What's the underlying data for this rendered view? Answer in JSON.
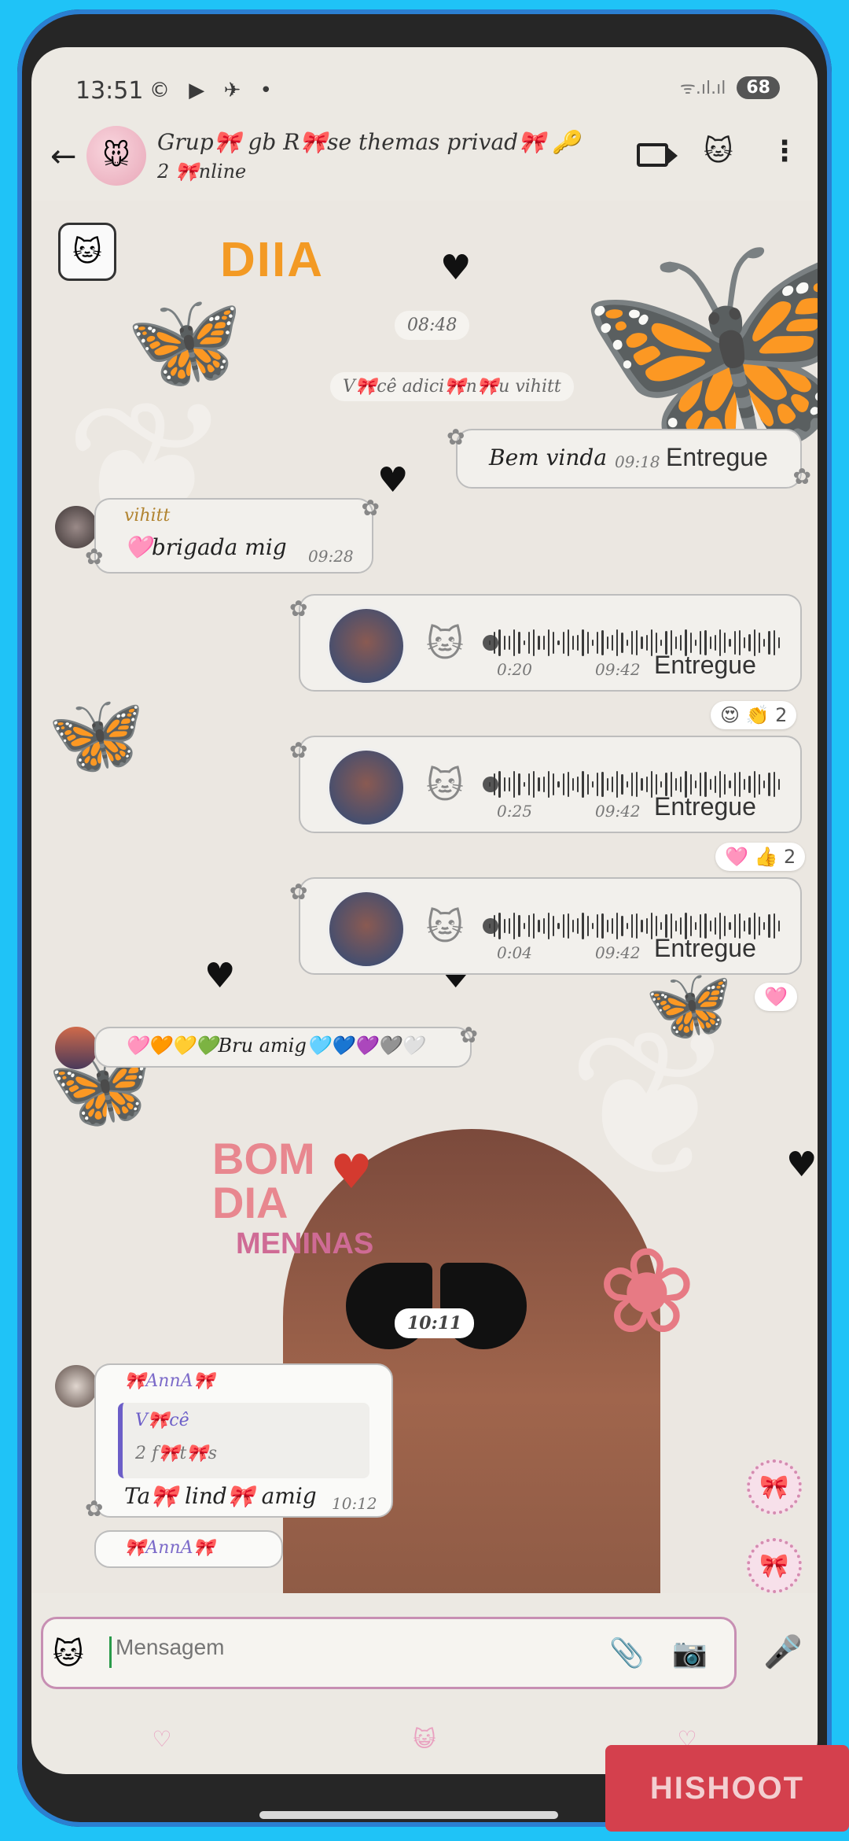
{
  "status_bar": {
    "time": "13:51",
    "app_icons": "© ▶ ✈ •",
    "signal": "ᯤ.ıl.ıl",
    "battery": "68"
  },
  "header": {
    "back_icon": "←",
    "group_name": "Grup🎀 gb R🎀se themas privad🎀 🔑",
    "group_status": "2 🎀nline",
    "avatar_icon": "🐭",
    "video_icon": "video-camera-icon",
    "cat_icon": "🐱",
    "more_icon": "⋮"
  },
  "chat": {
    "sticker_text": "DIIA",
    "time_pill_1": "08:48",
    "system_msg": "V🎀cê adici🎀n🎀u vihitt",
    "messages": [
      {
        "text": "Bem vinda",
        "time": "09:18",
        "status": "Entregue"
      },
      {
        "sender": "vihitt",
        "text": "🩷brigada mig",
        "time": "09:28"
      }
    ],
    "voice_messages": [
      {
        "duration": "0:20",
        "time": "09:42",
        "status": "Entregue",
        "reaction": "😍 👏 2"
      },
      {
        "duration": "0:25",
        "time": "09:42",
        "status": "Entregue",
        "reaction": "🩷 👍 2"
      },
      {
        "duration": "0:04",
        "time": "09:42",
        "status": "Entregue",
        "reaction": "🩷"
      }
    ],
    "emoji_msg": "🩷🧡💛💚Bru amig🩵💙💜🩶🤍",
    "bom_dia": [
      "BOM",
      "DIA"
    ],
    "meninas": "MENINAS",
    "time_pill_2": "10:11",
    "quoted_msg": {
      "sender": "🎀AnnA🎀",
      "quote_author": "V🎀cê",
      "quote_text": "2 f🎀t🎀s",
      "text": "Ta🎀 lind🎀 amig",
      "time": "10:12"
    },
    "next_sender": "🎀AnnA🎀"
  },
  "composer": {
    "placeholder": "Mensagem",
    "emoji_icon": "🐱",
    "attach_icon": "📎",
    "camera_icon": "📷",
    "mic_icon": "🎤"
  },
  "watermark": "HISHOOT"
}
